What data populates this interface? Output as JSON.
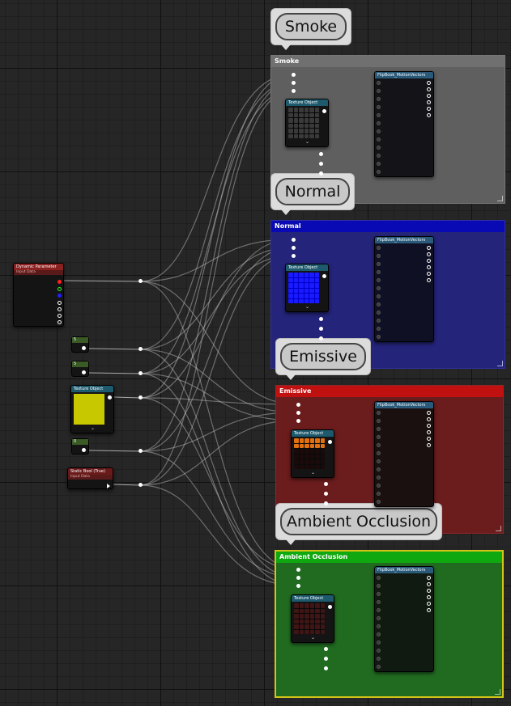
{
  "canvas": {
    "background": "#262626"
  },
  "groups": [
    {
      "id": "smoke",
      "bubble": "Smoke",
      "title": "Smoke",
      "color": "#5a5a5a",
      "title_color": "#6e6e6e",
      "texture": "smoke"
    },
    {
      "id": "normal",
      "bubble": "Normal",
      "title": "Normal",
      "color": "#1f1f78",
      "title_color": "#0a0ab4",
      "texture": "normal"
    },
    {
      "id": "emissive",
      "bubble": "Emissive",
      "title": "Emissive",
      "color": "#6b1c1c",
      "title_color": "#c01010",
      "texture": "emissive"
    },
    {
      "id": "ao",
      "bubble": "Ambient Occlusion",
      "title": "Ambient Occlusion",
      "color": "#206a20",
      "title_color": "#10a810",
      "texture": "ao"
    }
  ],
  "nodes": {
    "texture_object_label": "Texture Object",
    "flipbook_label": "FlipBook_MotionVectors",
    "dynamic_parameter": {
      "title": "Dynamic Parameter",
      "subtitle": "Input Data"
    },
    "static_bool": {
      "title": "Static Bool (True)",
      "subtitle": "Input Data"
    },
    "const1": {
      "value": "5"
    },
    "const2": {
      "value": "5"
    },
    "const3": {
      "value": "0"
    }
  },
  "colors": {
    "wire": "#c8c8c8",
    "selected_outline": "#d4c417",
    "texture_yellow": "#c8c800",
    "texture_blue": "#1010ff",
    "texture_smoke": "#303030",
    "texture_emissive": "#e07010"
  }
}
